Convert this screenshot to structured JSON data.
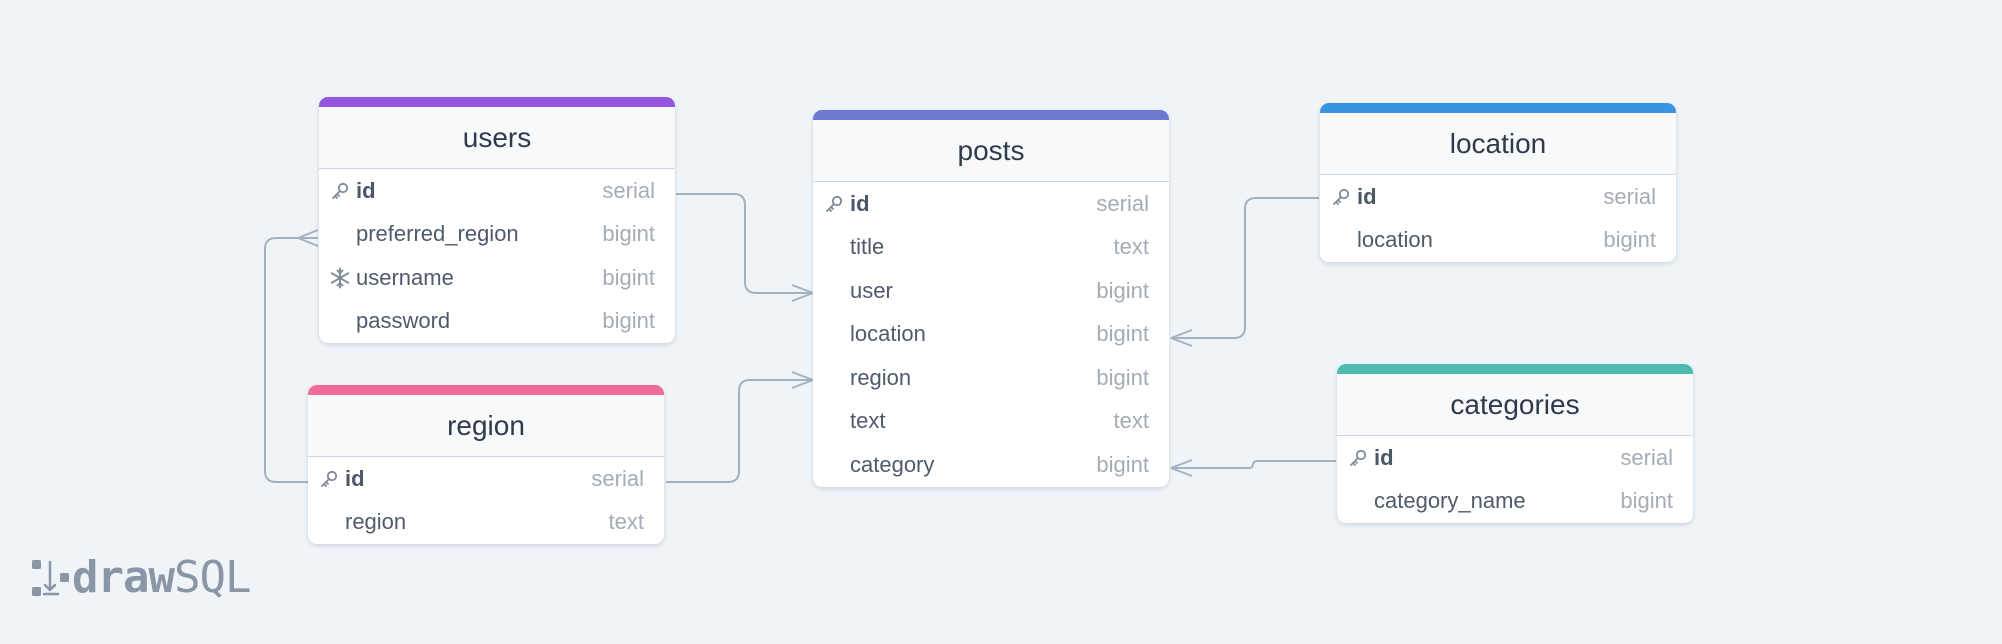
{
  "colors": {
    "background": "#eff4f8",
    "connector": "#a4b1c2",
    "users": "#9356dc",
    "posts": "#6c7ad2",
    "location": "#3993e0",
    "region": "#ef6b9a",
    "categories": "#4bbcaf"
  },
  "tables": {
    "users": {
      "title": "users",
      "fields": [
        {
          "name": "id",
          "type": "serial",
          "icon": "key-icon"
        },
        {
          "name": "preferred_region",
          "type": "bigint",
          "icon": ""
        },
        {
          "name": "username",
          "type": "bigint",
          "icon": "snowflake-icon"
        },
        {
          "name": "password",
          "type": "bigint",
          "icon": ""
        }
      ]
    },
    "posts": {
      "title": "posts",
      "fields": [
        {
          "name": "id",
          "type": "serial",
          "icon": "key-icon"
        },
        {
          "name": "title",
          "type": "text",
          "icon": ""
        },
        {
          "name": "user",
          "type": "bigint",
          "icon": ""
        },
        {
          "name": "location",
          "type": "bigint",
          "icon": ""
        },
        {
          "name": "region",
          "type": "bigint",
          "icon": ""
        },
        {
          "name": "text",
          "type": "text",
          "icon": ""
        },
        {
          "name": "category",
          "type": "bigint",
          "icon": ""
        }
      ]
    },
    "location": {
      "title": "location",
      "fields": [
        {
          "name": "id",
          "type": "serial",
          "icon": "key-icon"
        },
        {
          "name": "location",
          "type": "bigint",
          "icon": ""
        }
      ]
    },
    "region": {
      "title": "region",
      "fields": [
        {
          "name": "id",
          "type": "serial",
          "icon": "key-icon"
        },
        {
          "name": "region",
          "type": "text",
          "icon": ""
        }
      ]
    },
    "categories": {
      "title": "categories",
      "fields": [
        {
          "name": "id",
          "type": "serial",
          "icon": "key-icon"
        },
        {
          "name": "category_name",
          "type": "bigint",
          "icon": ""
        }
      ]
    }
  },
  "logo": {
    "bold": "draw",
    "light": "SQL"
  }
}
